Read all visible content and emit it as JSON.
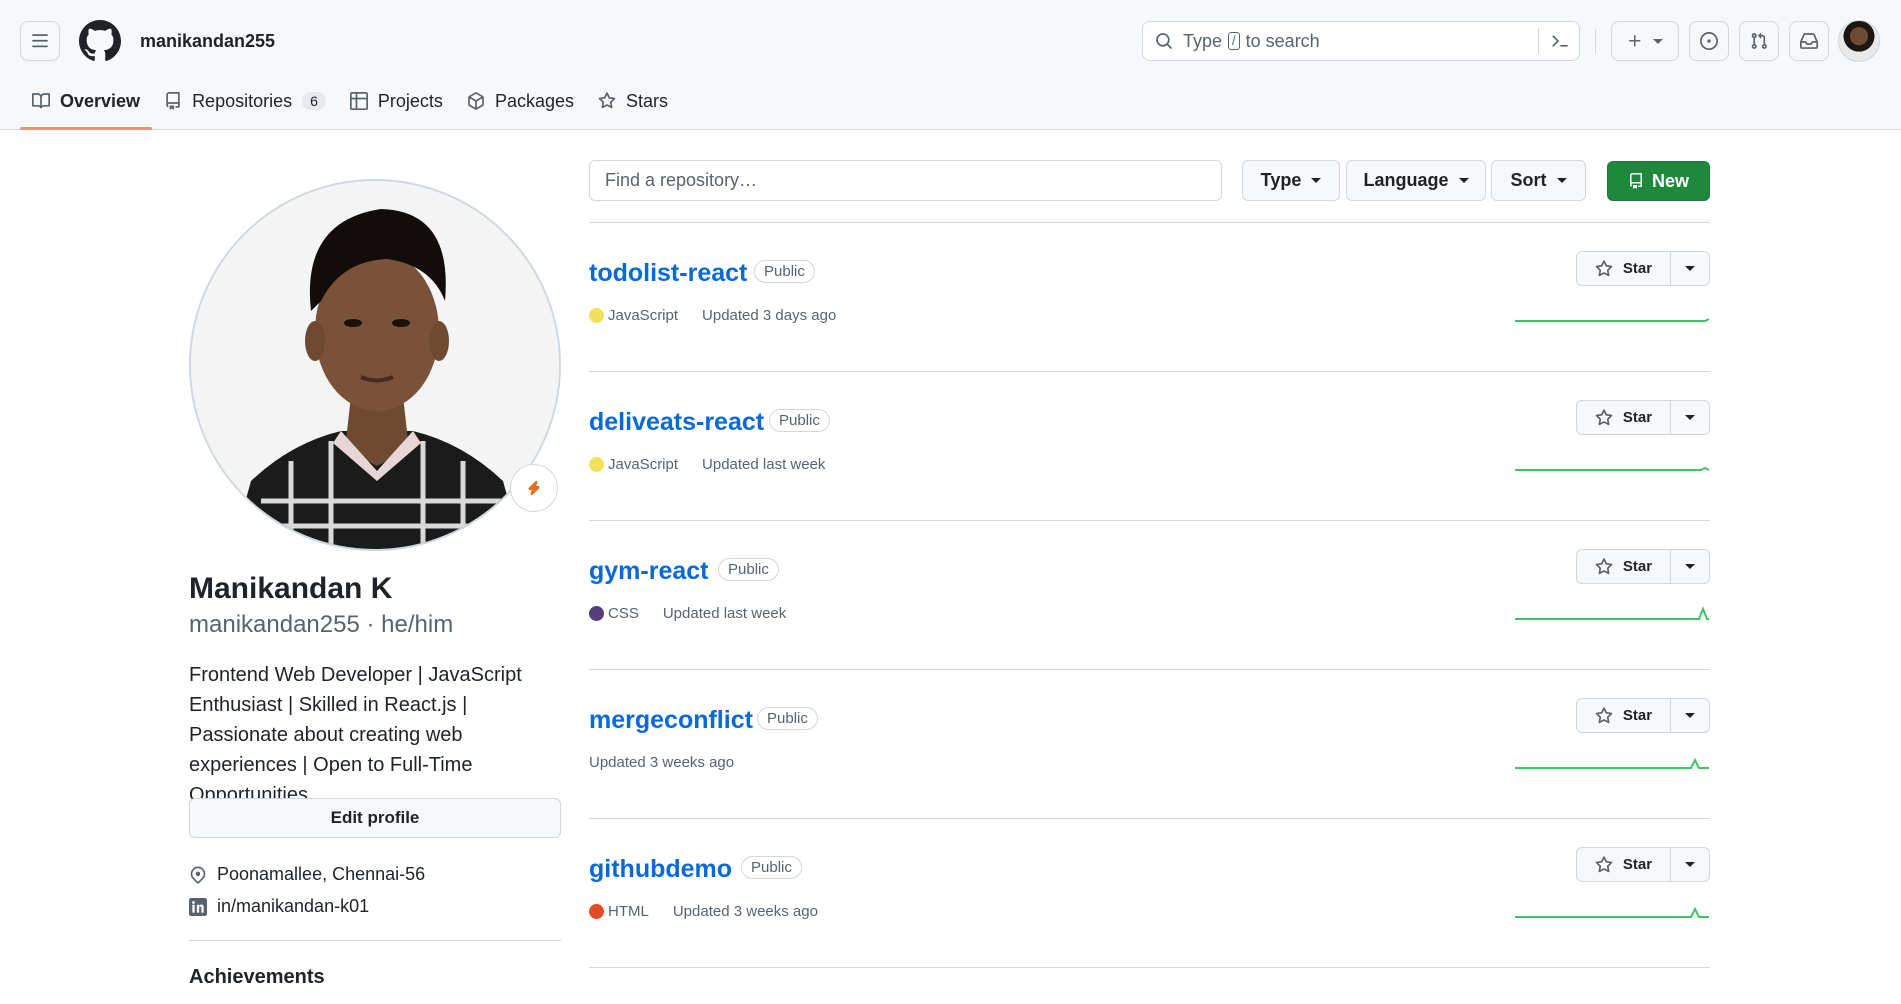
{
  "header": {
    "username": "manikandan255",
    "search": {
      "prefix": "Type",
      "key": "/",
      "suffix": "to search"
    }
  },
  "tabs": [
    {
      "label": "Overview",
      "selected": true
    },
    {
      "label": "Repositories",
      "count": "6"
    },
    {
      "label": "Projects"
    },
    {
      "label": "Packages"
    },
    {
      "label": "Stars"
    }
  ],
  "profile": {
    "full_name": "Manikandan K",
    "login": "manikandan255",
    "pronouns": "he/him",
    "bio": "Frontend Web Developer | JavaScript Enthusiast | Skilled in React.js | Passionate about creating web experiences | Open to Full-Time Opportunities",
    "edit_label": "Edit profile",
    "location": "Poonamallee, Chennai-56",
    "linkedin": "in/manikandan-k01",
    "achievements_title": "Achievements"
  },
  "filters": {
    "find_placeholder": "Find a repository…",
    "type_label": "Type",
    "language_label": "Language",
    "sort_label": "Sort",
    "new_label": "New"
  },
  "colors": {
    "accent_tab": "#fd8c73",
    "new_button": "#1f883d",
    "link": "#0969da",
    "sparkline": "#2da44e"
  },
  "repos": [
    {
      "name": "todolist-react",
      "visibility": "Public",
      "language": "JavaScript",
      "lang_color": "#f1e05a",
      "updated": "Updated 3 days ago",
      "star_label": "Star"
    },
    {
      "name": "deliveats-react",
      "visibility": "Public",
      "language": "JavaScript",
      "lang_color": "#f1e05a",
      "updated": "Updated last week",
      "star_label": "Star"
    },
    {
      "name": "gym-react",
      "visibility": "Public",
      "language": "CSS",
      "lang_color": "#563d7c",
      "updated": "Updated last week",
      "star_label": "Star"
    },
    {
      "name": "mergeconflict",
      "visibility": "Public",
      "language": "",
      "lang_color": "",
      "updated": "Updated 3 weeks ago",
      "star_label": "Star"
    },
    {
      "name": "githubdemo",
      "visibility": "Public",
      "language": "HTML",
      "lang_color": "#e34c26",
      "updated": "Updated 3 weeks ago",
      "star_label": "Star"
    }
  ]
}
